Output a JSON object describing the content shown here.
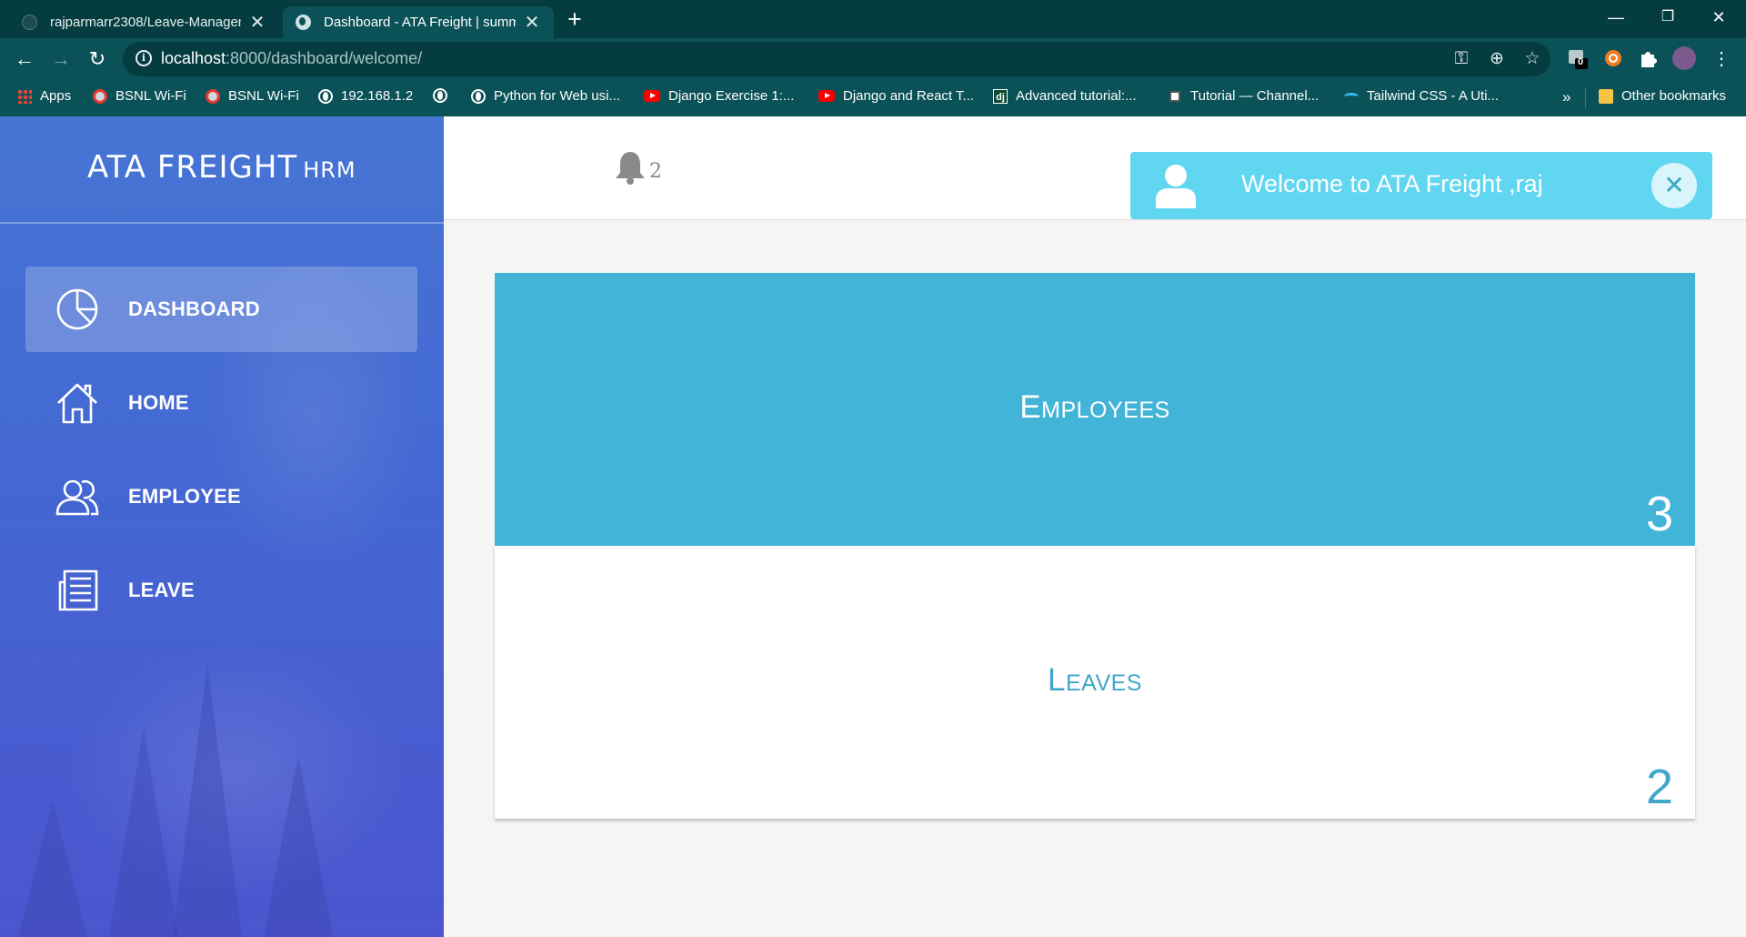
{
  "browser": {
    "tabs": [
      {
        "title": "rajparmarr2308/Leave-Managem",
        "close": "✕"
      },
      {
        "title": "Dashboard - ATA Freight | summ",
        "close": "✕"
      }
    ],
    "new_tab": "+",
    "window_controls": {
      "minimize": "—",
      "restore": "❐",
      "close": "✕"
    },
    "url_host": "localhost",
    "url_path": ":8000/dashboard/welcome/",
    "extension_badge": "0",
    "bookmarks": [
      {
        "label": "Apps",
        "icon": "apps-grid-icon"
      },
      {
        "label": "BSNL Wi-Fi",
        "icon": "bsnl-icon"
      },
      {
        "label": "BSNL Wi-Fi",
        "icon": "bsnl-icon"
      },
      {
        "label": "192.168.1.2",
        "icon": "globe-icon"
      },
      {
        "label": "",
        "icon": "globe-icon"
      },
      {
        "label": "Python for Web usi...",
        "icon": "globe-icon"
      },
      {
        "label": "Django Exercise 1:...",
        "icon": "youtube-icon"
      },
      {
        "label": "Django and React T...",
        "icon": "youtube-icon"
      },
      {
        "label": "Advanced tutorial:...",
        "icon": "django-icon"
      },
      {
        "label": "Tutorial — Channel...",
        "icon": "document-icon"
      },
      {
        "label": "Tailwind CSS - A Uti...",
        "icon": "tailwind-icon"
      }
    ],
    "bookmarks_overflow": "»",
    "other_bookmarks": "Other bookmarks"
  },
  "sidebar": {
    "brand": "ATA FREIGHT",
    "brand_suffix": "HRM",
    "items": [
      {
        "label": "DASHBOARD",
        "icon": "pie-chart-icon",
        "active": true
      },
      {
        "label": "HOME",
        "icon": "home-icon",
        "active": false
      },
      {
        "label": "EMPLOYEE",
        "icon": "users-icon",
        "active": false
      },
      {
        "label": "LEAVE",
        "icon": "newspaper-icon",
        "active": false
      }
    ]
  },
  "topbar": {
    "notification_count": "2",
    "toast": {
      "message": "Welcome to ATA Freight ,raj",
      "close": "✕"
    }
  },
  "cards": [
    {
      "title": "Employees",
      "count": "3"
    },
    {
      "title": "Leaves",
      "count": "2"
    }
  ],
  "colors": {
    "tab_bar": "#053c3f",
    "toolbar": "#0a5257",
    "sidebar_top": "#4675d4",
    "sidebar_bottom": "#4b55cf",
    "toast": "#61d6f0",
    "employees_card": "#42b4d8",
    "leaves_text": "#42a6cc"
  }
}
